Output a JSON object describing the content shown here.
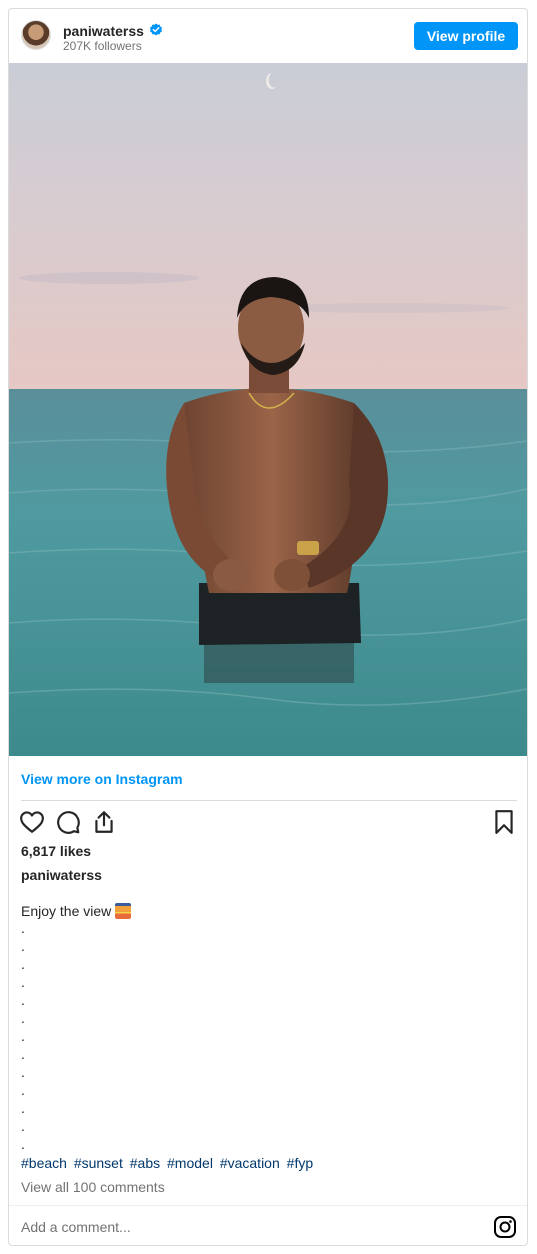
{
  "header": {
    "username": "paniwaterss",
    "followers": "207K followers",
    "view_profile_label": "View profile"
  },
  "post": {
    "view_more_label": "View more on Instagram",
    "likes": "6,817 likes",
    "caption_user": "paniwaterss",
    "caption_text": "Enjoy the view",
    "caption_emoji": "sunset-emoji",
    "dots": [
      ".",
      ".",
      ".",
      ".",
      ".",
      ".",
      ".",
      ".",
      ".",
      ".",
      ".",
      ".",
      "."
    ],
    "hashtags": [
      "#beach",
      "#sunset",
      "#abs",
      "#model",
      "#vacation",
      "#fyp"
    ],
    "view_comments_label": "View all 100 comments"
  },
  "comment": {
    "placeholder": "Add a comment..."
  },
  "icons": {
    "like": "heart-icon",
    "comment": "comment-icon",
    "share": "share-icon",
    "save": "bookmark-icon",
    "instagram": "instagram-icon",
    "verified": "verified-badge-icon"
  },
  "colors": {
    "accent": "#0095f6",
    "hashtag": "#00376b",
    "muted": "#737373"
  }
}
